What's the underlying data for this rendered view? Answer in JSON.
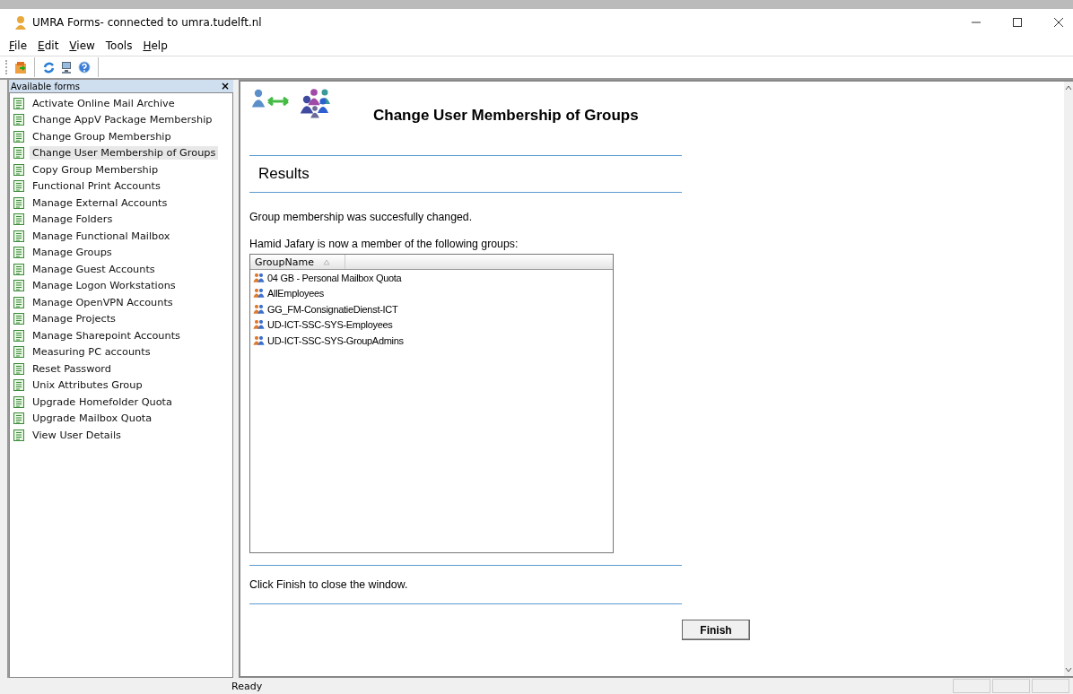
{
  "window": {
    "title": "UMRA Forms- connected to umra.tudelft.nl"
  },
  "menu": [
    {
      "label": "File",
      "underline_first": true
    },
    {
      "label": "Edit",
      "underline_first": true
    },
    {
      "label": "View",
      "underline_first": true
    },
    {
      "label": "Tools",
      "underline_first": false
    },
    {
      "label": "Help",
      "underline_first": true
    }
  ],
  "toolbar": [
    {
      "kind": "open"
    },
    {
      "kind": "refresh"
    },
    {
      "kind": "computer"
    },
    {
      "kind": "help"
    }
  ],
  "sidebar": {
    "title": "Available forms",
    "close": "×",
    "items": [
      {
        "label": "Activate Online Mail Archive",
        "selected": false
      },
      {
        "label": "Change AppV Package Membership",
        "selected": false
      },
      {
        "label": "Change Group Membership",
        "selected": false
      },
      {
        "label": "Change User Membership of Groups",
        "selected": true
      },
      {
        "label": "Copy Group Membership",
        "selected": false
      },
      {
        "label": "Functional Print Accounts",
        "selected": false
      },
      {
        "label": "Manage External Accounts",
        "selected": false
      },
      {
        "label": "Manage Folders",
        "selected": false
      },
      {
        "label": "Manage Functional Mailbox",
        "selected": false
      },
      {
        "label": "Manage Groups",
        "selected": false
      },
      {
        "label": "Manage Guest Accounts",
        "selected": false
      },
      {
        "label": "Manage Logon Workstations",
        "selected": false
      },
      {
        "label": "Manage OpenVPN Accounts",
        "selected": false
      },
      {
        "label": "Manage Projects",
        "selected": false
      },
      {
        "label": "Manage Sharepoint Accounts",
        "selected": false
      },
      {
        "label": "Measuring PC accounts",
        "selected": false
      },
      {
        "label": "Reset Password",
        "selected": false
      },
      {
        "label": "Unix Attributes Group",
        "selected": false
      },
      {
        "label": "Upgrade Homefolder Quota",
        "selected": false
      },
      {
        "label": "Upgrade Mailbox Quota",
        "selected": false
      },
      {
        "label": "View User Details",
        "selected": false
      }
    ]
  },
  "form": {
    "title": "Change User Membership of Groups",
    "section": "Results",
    "message": "Group membership was succesfully changed.",
    "intro": "Hamid Jafary is now a member of the following groups:",
    "table": {
      "columns": [
        {
          "label": "GroupName",
          "sorted_ascending": true
        }
      ],
      "rows": [
        "04 GB - Personal Mailbox Quota",
        "AllEmployees",
        "GG_FM-ConsignatieDienst-ICT",
        "UD-ICT-SSC-SYS-Employees",
        "UD-ICT-SSC-SYS-GroupAdmins"
      ]
    },
    "footer": "Click Finish to close the window.",
    "button": "Finish"
  },
  "status_bar": {
    "text": "Ready"
  }
}
